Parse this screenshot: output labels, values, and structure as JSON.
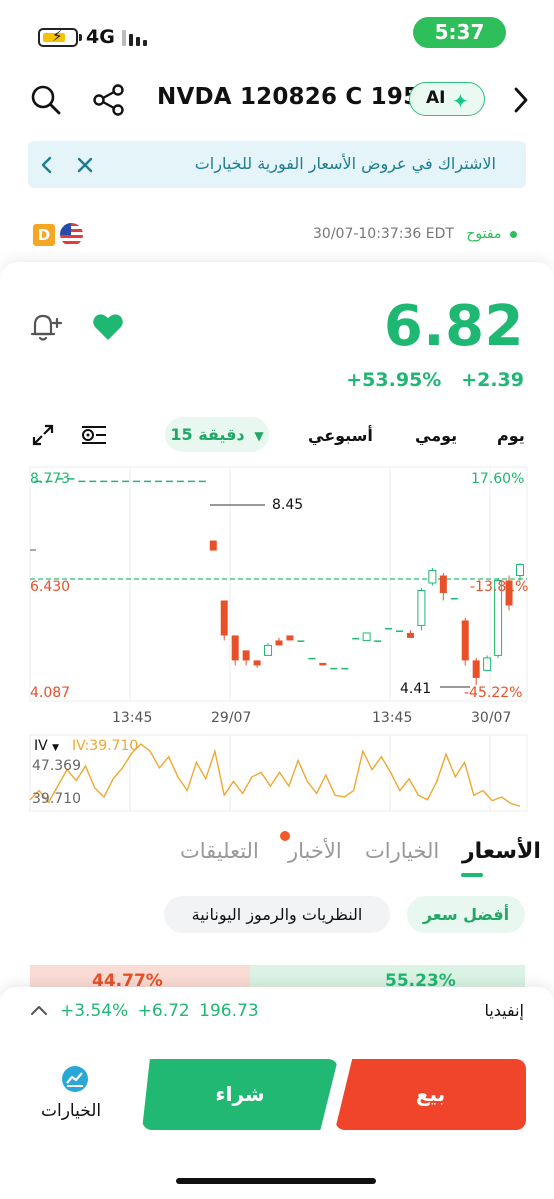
{
  "status_bar": {
    "network": "4G",
    "time": "5:37"
  },
  "header": {
    "symbol_title": "NVDA 120826 C 195",
    "ai_label": "AI"
  },
  "banner": {
    "text": "الاشتراك في عروض الأسعار الفورية للخيارات"
  },
  "market": {
    "status": "مفتوح",
    "timestamp": "30/07-10:37:36 EDT",
    "badge": "D"
  },
  "quote": {
    "price": "6.82",
    "change_abs": "+2.39",
    "change_pct": "+53.95%"
  },
  "periods": {
    "day": "يوم",
    "daily": "يومي",
    "weekly": "أسبوعي",
    "interval": "15 دقيقة"
  },
  "chart": {
    "y_top_left": "8.773",
    "y_mid_left": "6.430",
    "y_bot_left": "4.087",
    "y_top_right": "17.60%",
    "y_mid_right": "-13.81%",
    "y_bot_right": "-45.22%",
    "high_label": "8.45",
    "low_label": "4.41",
    "x_labels": [
      "13:45",
      "29/07",
      "13:45",
      "30/07"
    ],
    "iv_selector": "IV",
    "iv_value": "IV:39.710",
    "iv_top": "47.369",
    "iv_bot": "39.710"
  },
  "tabs": {
    "prices": "الأسعار",
    "options": "الخيارات",
    "news": "الأخبار",
    "comments": "التعليقات"
  },
  "chips": {
    "best_price": "أفضل سعر",
    "greeks": "النظريات والرموز اليونانية"
  },
  "ratio": {
    "left": "44.77%",
    "right": "55.23%"
  },
  "underlying": {
    "name": "إنفيديا",
    "price": "196.73",
    "change": "+6.72",
    "change_pct": "+3.54%"
  },
  "actions": {
    "options_label": "الخيارات",
    "buy": "شراء",
    "sell": "بيع"
  },
  "colors": {
    "up": "#1fb872",
    "down": "#e8502a",
    "accent": "#2fbf5a",
    "iv_line": "#f0a830"
  },
  "chart_data": {
    "type": "candlestick",
    "title": "",
    "ylim": [
      4.087,
      8.773
    ],
    "reference_price": 6.43,
    "high_annotation": 8.45,
    "low_annotation": 4.41,
    "x_ticks": [
      "13:45",
      "29/07",
      "13:45",
      "30/07"
    ],
    "candles": [
      {
        "o": 8.5,
        "c": 8.5,
        "h": 8.5,
        "l": 8.5
      },
      {
        "o": 8.5,
        "c": 8.5,
        "h": 8.5,
        "l": 8.5
      },
      {
        "o": 8.55,
        "c": 8.55,
        "h": 8.55,
        "l": 8.55
      },
      {
        "o": 8.55,
        "c": 8.55,
        "h": 8.55,
        "l": 8.55
      },
      {
        "o": 8.5,
        "c": 8.5,
        "h": 8.5,
        "l": 8.5
      },
      {
        "o": 8.5,
        "c": 8.5,
        "h": 8.5,
        "l": 8.5
      },
      {
        "o": 8.5,
        "c": 8.5,
        "h": 8.5,
        "l": 8.5
      },
      {
        "o": 8.5,
        "c": 8.5,
        "h": 8.5,
        "l": 8.5
      },
      {
        "o": 8.5,
        "c": 8.5,
        "h": 8.5,
        "l": 8.5
      },
      {
        "o": 8.5,
        "c": 8.5,
        "h": 8.5,
        "l": 8.5
      },
      {
        "o": 8.5,
        "c": 8.5,
        "h": 8.5,
        "l": 8.5
      },
      {
        "o": 8.5,
        "c": 8.5,
        "h": 8.5,
        "l": 8.5
      },
      {
        "o": 8.5,
        "c": 8.5,
        "h": 8.5,
        "l": 8.5
      },
      {
        "o": 8.5,
        "c": 8.5,
        "h": 8.5,
        "l": 8.5
      },
      {
        "o": 8.5,
        "c": 8.5,
        "h": 8.5,
        "l": 8.5
      },
      {
        "o": 8.5,
        "c": 8.5,
        "h": 8.5,
        "l": 8.5
      },
      {
        "o": 7.3,
        "c": 7.1,
        "h": 7.3,
        "l": 7.1
      },
      {
        "o": 6.1,
        "c": 5.4,
        "h": 6.1,
        "l": 5.3
      },
      {
        "o": 5.4,
        "c": 4.9,
        "h": 5.4,
        "l": 4.8
      },
      {
        "o": 5.1,
        "c": 4.9,
        "h": 5.1,
        "l": 4.8
      },
      {
        "o": 4.9,
        "c": 4.8,
        "h": 4.9,
        "l": 4.75
      },
      {
        "o": 5.0,
        "c": 5.2,
        "h": 5.25,
        "l": 5.0
      },
      {
        "o": 5.3,
        "c": 5.2,
        "h": 5.35,
        "l": 5.2
      },
      {
        "o": 5.4,
        "c": 5.3,
        "h": 5.4,
        "l": 5.3
      },
      {
        "o": 5.3,
        "c": 5.3,
        "h": 5.3,
        "l": 5.3
      },
      {
        "o": 4.95,
        "c": 4.95,
        "h": 4.95,
        "l": 4.95
      },
      {
        "o": 4.85,
        "c": 4.8,
        "h": 4.85,
        "l": 4.8
      },
      {
        "o": 4.75,
        "c": 4.75,
        "h": 4.75,
        "l": 4.75
      },
      {
        "o": 4.75,
        "c": 4.75,
        "h": 4.75,
        "l": 4.75
      },
      {
        "o": 5.35,
        "c": 5.35,
        "h": 5.35,
        "l": 5.35
      },
      {
        "o": 5.3,
        "c": 5.45,
        "h": 5.45,
        "l": 5.3
      },
      {
        "o": 5.3,
        "c": 5.3,
        "h": 5.3,
        "l": 5.3
      },
      {
        "o": 5.55,
        "c": 5.55,
        "h": 5.55,
        "l": 5.55
      },
      {
        "o": 5.5,
        "c": 5.5,
        "h": 5.5,
        "l": 5.5
      },
      {
        "o": 5.45,
        "c": 5.35,
        "h": 5.5,
        "l": 5.35
      },
      {
        "o": 5.6,
        "c": 6.3,
        "h": 6.35,
        "l": 5.5
      },
      {
        "o": 6.45,
        "c": 6.7,
        "h": 6.75,
        "l": 6.4
      },
      {
        "o": 6.6,
        "c": 6.25,
        "h": 6.65,
        "l": 6.1
      },
      {
        "o": 6.15,
        "c": 6.15,
        "h": 6.15,
        "l": 6.15
      },
      {
        "o": 5.7,
        "c": 4.9,
        "h": 5.75,
        "l": 4.8
      },
      {
        "o": 4.9,
        "c": 4.55,
        "h": 4.95,
        "l": 4.41
      },
      {
        "o": 4.7,
        "c": 4.95,
        "h": 5.0,
        "l": 4.7
      },
      {
        "o": 5.0,
        "c": 6.5,
        "h": 6.55,
        "l": 4.95
      },
      {
        "o": 6.5,
        "c": 6.0,
        "h": 6.6,
        "l": 5.9
      },
      {
        "o": 6.6,
        "c": 6.82,
        "h": 6.85,
        "l": 6.5
      }
    ],
    "iv_series": {
      "name": "IV",
      "ylim": [
        39.71,
        47.369
      ],
      "values": [
        40.5,
        41.5,
        40.2,
        42.0,
        43.8,
        42.6,
        44.2,
        41.8,
        40.8,
        42.8,
        44.0,
        45.6,
        46.6,
        45.8,
        44.0,
        45.2,
        43.0,
        41.5,
        44.6,
        42.8,
        45.8,
        41.0,
        42.5,
        41.2,
        43.0,
        43.5,
        42.0,
        43.5,
        42.0,
        44.8,
        42.5,
        41.2,
        43.2,
        41.0,
        40.8,
        41.5,
        45.8,
        43.8,
        45.2,
        43.5,
        41.5,
        42.8,
        41.0,
        40.5,
        42.5,
        45.5,
        43.0,
        44.6,
        41.0,
        41.5,
        40.4,
        40.8,
        40.1,
        39.8
      ]
    }
  }
}
